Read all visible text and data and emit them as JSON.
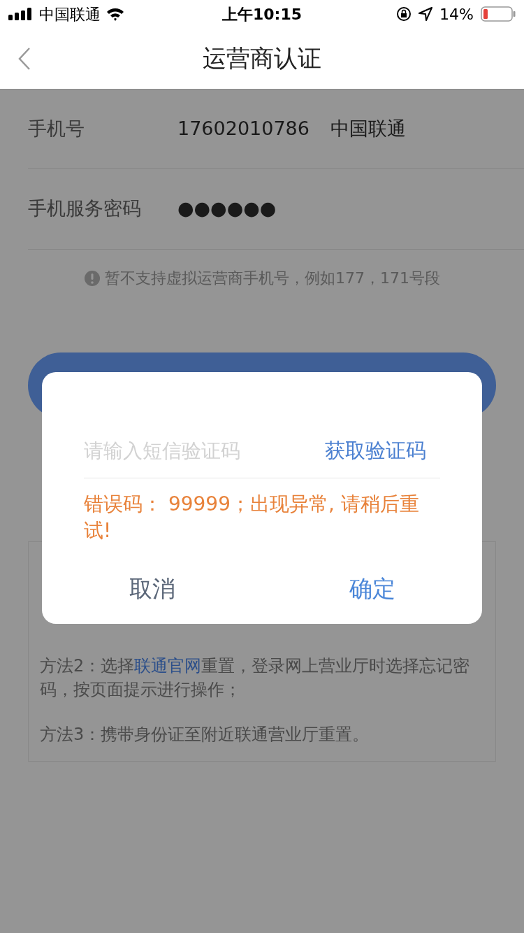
{
  "status_bar": {
    "carrier": "中国联通",
    "time": "上午10:15",
    "battery": "14%"
  },
  "nav": {
    "title": "运营商认证"
  },
  "form": {
    "rows": [
      {
        "label": "手机号",
        "value": "17602010786",
        "extra": "中国联通"
      },
      {
        "label": "手机服务密码",
        "value": "●●●●●●"
      }
    ],
    "notice": "暂不支持虚拟运营商手机号，例如177，171号段"
  },
  "help": {
    "methods": [
      {
        "parts": [
          {
            "text": "方法2：选择",
            "link": false
          },
          {
            "text": "联通官网",
            "link": true
          },
          {
            "text": "重置，登录网上营业厅时选择忘记密码，按页面提示进行操作；",
            "link": false
          }
        ]
      },
      {
        "parts": [
          {
            "text": "方法3：携带身份证至附近联通营业厅重置。",
            "link": false
          }
        ]
      }
    ]
  },
  "dialog": {
    "code_field": {
      "placeholder": "请输入短信验证码"
    },
    "get_code": "获取验证码",
    "error": "错误码：  99999；出现异常, 请稍后重试!",
    "buttons": [
      {
        "label": "取消",
        "primary": false
      },
      {
        "label": "确定",
        "primary": true
      }
    ]
  }
}
